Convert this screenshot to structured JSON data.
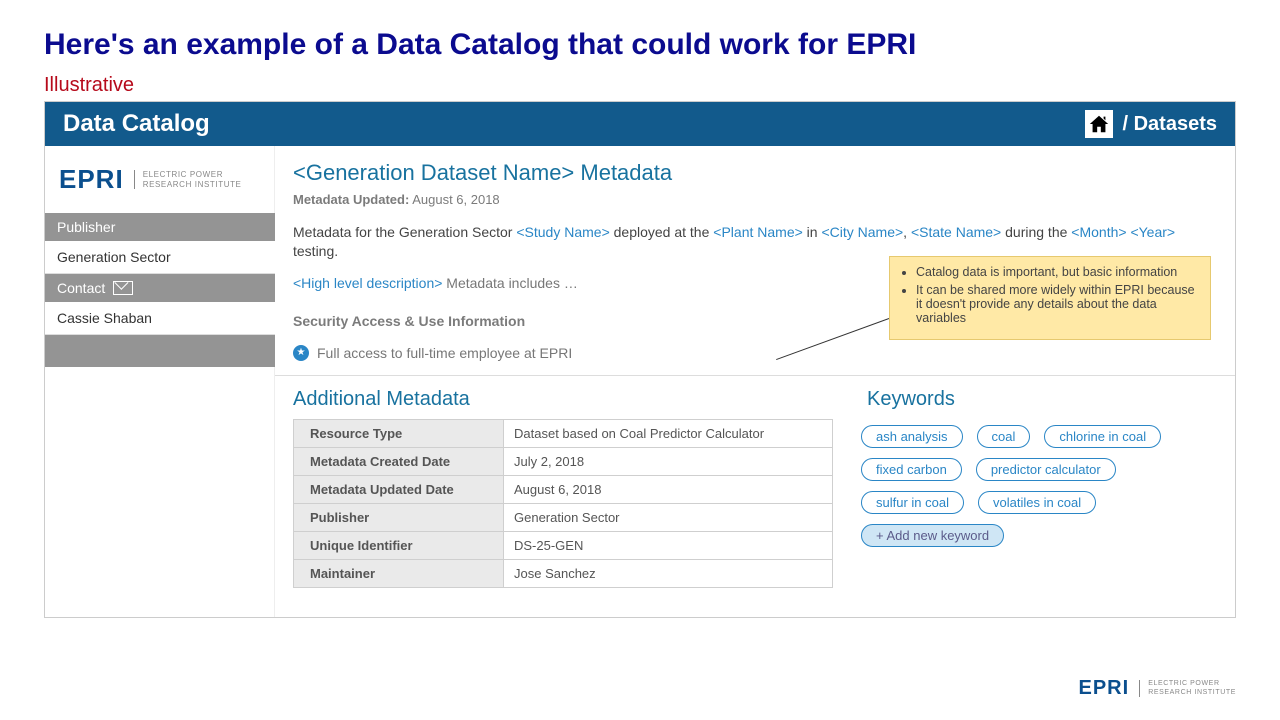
{
  "slide": {
    "title": "Here's an example of a Data Catalog that could work for EPRI",
    "subtitle": "Illustrative"
  },
  "header": {
    "app_title": "Data Catalog",
    "breadcrumb": "/ Datasets"
  },
  "logo": {
    "mark": "EPRI",
    "sub_line1": "ELECTRIC POWER",
    "sub_line2": "RESEARCH INSTITUTE"
  },
  "sidebar": {
    "publisher_h": "Publisher",
    "publisher_value": "Generation Sector",
    "contact_h": "Contact",
    "contact_value": "Cassie Shaban"
  },
  "main": {
    "dataset_title": "<Generation Dataset Name>  Metadata",
    "updated_label": "Metadata Updated:",
    "updated_value": "August 6, 2018",
    "desc_prefix": "Metadata for the Generation Sector ",
    "ph_study": "<Study Name>",
    "desc_mid1": "  deployed at the ",
    "ph_plant": "<Plant Name>",
    "desc_mid2": "  in ",
    "ph_city": "<City Name>",
    "desc_comma": ", ",
    "ph_state": "<State Name>",
    "desc_mid3": "  during the ",
    "ph_month": "<Month>",
    "desc_sp": "  ",
    "ph_year": "<Year>",
    "desc_suffix": " testing.",
    "high_ph": "<High level description>",
    "high_suffix": " Metadata includes …",
    "security_h": "Security Access & Use Information",
    "security_text": "Full access to full-time employee at EPRI"
  },
  "callout": {
    "items": [
      "Catalog data is important, but basic information",
      "It can be shared more widely within EPRI because it doesn't provide any details about the data variables"
    ]
  },
  "meta": {
    "heading": "Additional Metadata",
    "rows": [
      {
        "k": "Resource Type",
        "v": "Dataset based on Coal Predictor Calculator"
      },
      {
        "k": "Metadata Created Date",
        "v": "July 2, 2018"
      },
      {
        "k": "Metadata Updated Date",
        "v": "August 6, 2018"
      },
      {
        "k": "Publisher",
        "v": "Generation Sector"
      },
      {
        "k": "Unique Identifier",
        "v": "DS-25-GEN"
      },
      {
        "k": "Maintainer",
        "v": "Jose Sanchez"
      }
    ]
  },
  "keywords": {
    "heading": "Keywords",
    "tags": [
      {
        "label": "ash analysis",
        "selected": false
      },
      {
        "label": "coal",
        "selected": false
      },
      {
        "label": "chlorine in coal",
        "selected": false
      },
      {
        "label": "fixed carbon",
        "selected": false
      },
      {
        "label": "predictor calculator",
        "selected": false
      },
      {
        "label": "sulfur in coal",
        "selected": false
      },
      {
        "label": "volatiles in coal",
        "selected": false
      }
    ],
    "add_label": "+ Add new keyword"
  }
}
